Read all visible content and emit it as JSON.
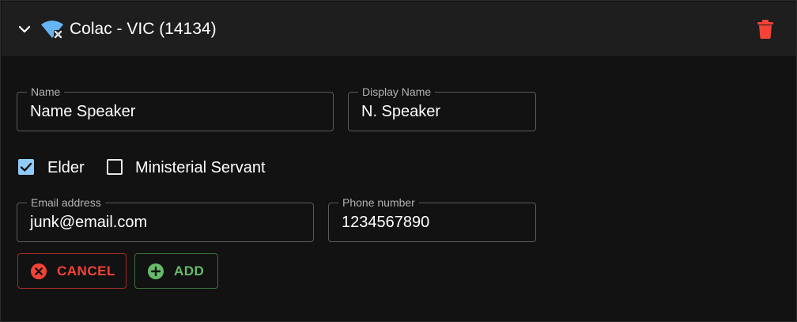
{
  "header": {
    "title": "Colac - VIC (14134)",
    "icons": {
      "expand": "chevron-down-icon",
      "status": "wifi-off-icon",
      "delete": "trash-icon"
    }
  },
  "form": {
    "name": {
      "label": "Name",
      "value": "Name Speaker"
    },
    "display_name": {
      "label": "Display Name",
      "value": "N. Speaker"
    },
    "elder": {
      "label": "Elder",
      "checked": true
    },
    "ministerial_servant": {
      "label": "Ministerial Servant",
      "checked": false
    },
    "email": {
      "label": "Email address",
      "value": "junk@email.com"
    },
    "phone": {
      "label": "Phone number",
      "value": "1234567890"
    }
  },
  "actions": {
    "cancel_label": "CANCEL",
    "add_label": "ADD"
  },
  "colors": {
    "checkbox_accent": "#90caf9",
    "danger": "#f44336",
    "success": "#66bb6a",
    "wifi_icon": "#64b5f6"
  }
}
